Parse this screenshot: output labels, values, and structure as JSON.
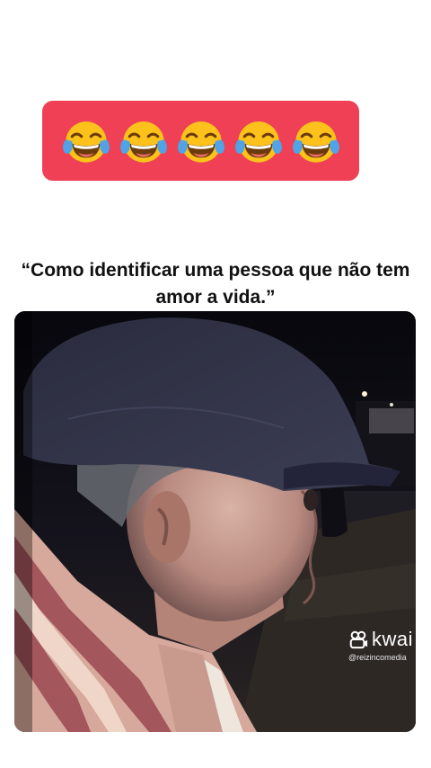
{
  "banner": {
    "emojis": [
      "face-with-tears-of-joy-icon",
      "face-with-tears-of-joy-icon",
      "face-with-tears-of-joy-icon",
      "face-with-tears-of-joy-icon",
      "face-with-tears-of-joy-icon"
    ],
    "background_color": "#ef4056"
  },
  "caption": {
    "text": "“Como identificar uma pessoa que não tem amor a vida.”"
  },
  "video": {
    "watermark": {
      "brand": "kwai",
      "handle": "@reizincomedia"
    }
  }
}
